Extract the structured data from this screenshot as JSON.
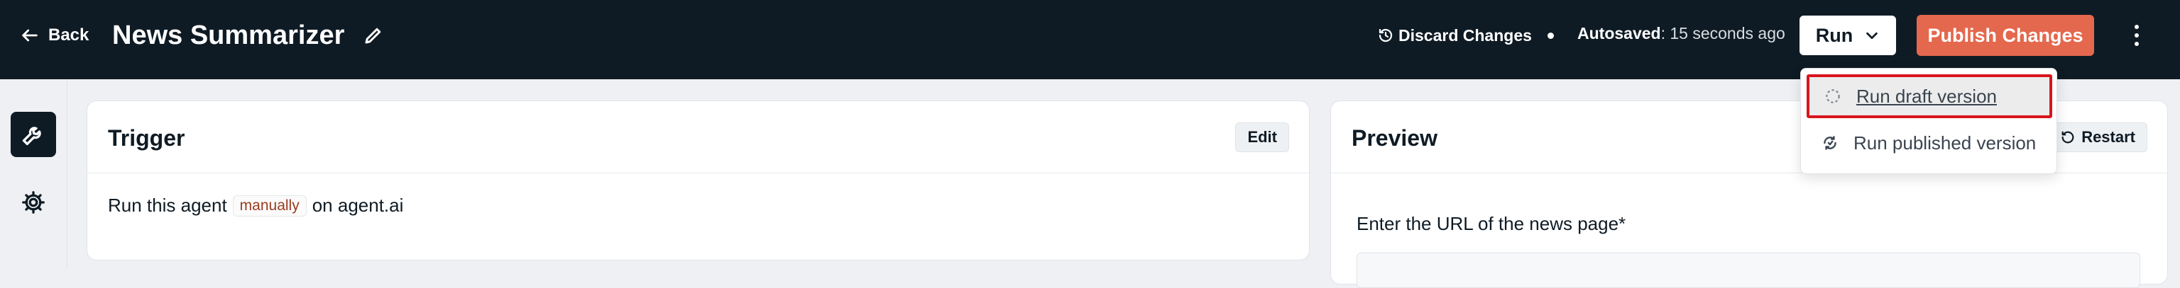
{
  "header": {
    "back_label": "Back",
    "title": "News Summarizer",
    "discard_label": "Discard Changes",
    "autosaved_label": "Autosaved",
    "autosaved_value": ": 15 seconds ago",
    "run_label": "Run",
    "publish_label": "Publish Changes"
  },
  "run_menu": {
    "items": [
      {
        "label": "Run draft version",
        "icon": "dashed-circle-icon",
        "highlighted": true
      },
      {
        "label": "Run published version",
        "icon": "refresh-globe-icon",
        "highlighted": false
      }
    ]
  },
  "sidebar": {
    "items": [
      {
        "icon": "wrench-icon",
        "active": true
      },
      {
        "icon": "gear-icon",
        "active": false
      }
    ]
  },
  "trigger": {
    "title": "Trigger",
    "edit_label": "Edit",
    "text_before": "Run this agent",
    "tag": "manually",
    "text_after": "on agent.ai"
  },
  "preview": {
    "title": "Preview",
    "restart_label": "Restart",
    "field_label": "Enter the URL of the news page*",
    "field_value": ""
  },
  "colors": {
    "topbar_bg": "#0f1b24",
    "publish_bg": "#e4684d",
    "highlight_border": "#d9151d",
    "page_bg": "#eef0f3"
  }
}
